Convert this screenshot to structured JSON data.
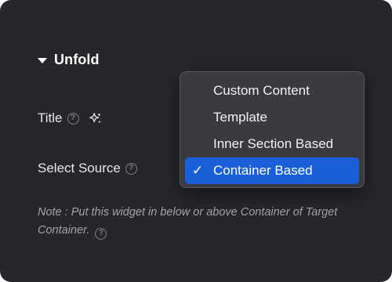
{
  "section": {
    "title": "Unfold"
  },
  "fields": {
    "title_label": "Title",
    "source_label": "Select Source"
  },
  "dropdown": {
    "options": [
      {
        "label": "Custom Content",
        "selected": false
      },
      {
        "label": "Template",
        "selected": false
      },
      {
        "label": "Inner Section Based",
        "selected": false
      },
      {
        "label": "Container Based",
        "selected": true
      }
    ],
    "check_mark": "✓"
  },
  "note": {
    "text": "Note : Put this widget in below or above Container of Target Container."
  },
  "icons": {
    "help": "?",
    "help_icon": "question-circle-icon",
    "ai_icon": "sparkle-icon",
    "section_icon": "caret-down-icon"
  },
  "colors": {
    "panel_bg": "#26272b",
    "dropdown_bg": "#3a3b40",
    "selected_bg": "#1b5fd8",
    "note_text": "#a3a4aa"
  }
}
